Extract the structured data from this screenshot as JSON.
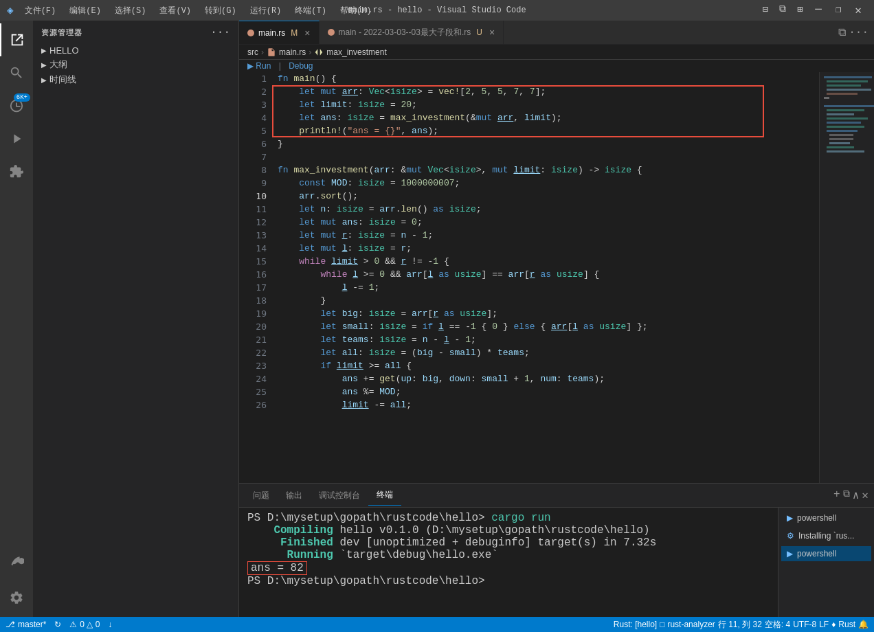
{
  "titlebar": {
    "icon": "◈",
    "menus": [
      "文件(F)",
      "编辑(E)",
      "选择(S)",
      "查看(V)",
      "转到(G)",
      "运行(R)",
      "终端(T)",
      "帮助(H)"
    ],
    "title": "main.rs - hello - Visual Studio Code",
    "controls": [
      "⊟",
      "❐",
      "✕"
    ]
  },
  "sidebar": {
    "title": "资源管理器",
    "tree": [
      {
        "label": "HELLO",
        "level": 0,
        "expanded": true
      },
      {
        "label": "大纲",
        "level": 0,
        "expanded": false
      },
      {
        "label": "时间线",
        "level": 0,
        "expanded": false
      }
    ]
  },
  "tabs": [
    {
      "label": "main.rs",
      "modified": true,
      "active": true,
      "icon": "rust"
    },
    {
      "label": "main - 2022-03-03--03最大子段和.rs",
      "modified": true,
      "active": false,
      "icon": "rust"
    }
  ],
  "breadcrumb": {
    "parts": [
      "src",
      "main.rs",
      "max_investment"
    ]
  },
  "run_debug": {
    "label": "Run | Debug"
  },
  "code": {
    "lines": [
      {
        "num": 1,
        "text": "fn main() {"
      },
      {
        "num": 2,
        "text": "    let mut arr: Vec<isize> = vec![2, 5, 5, 7, 7];"
      },
      {
        "num": 3,
        "text": "    let limit: isize = 20;"
      },
      {
        "num": 4,
        "text": "    let ans: isize = max_investment(&mut arr, limit);"
      },
      {
        "num": 5,
        "text": "    println!(\"ans = {}\", ans);"
      },
      {
        "num": 6,
        "text": "}"
      },
      {
        "num": 7,
        "text": ""
      },
      {
        "num": 8,
        "text": "fn max_investment(arr: &mut Vec<isize>, mut limit: isize) -> isize {"
      },
      {
        "num": 9,
        "text": "    const MOD: isize = 1000000007;"
      },
      {
        "num": 10,
        "text": "    arr.sort();"
      },
      {
        "num": 11,
        "text": "    let n: isize = arr.len() as isize;"
      },
      {
        "num": 12,
        "text": "    let mut ans: isize = 0;"
      },
      {
        "num": 13,
        "text": "    let mut r: isize = n - 1;"
      },
      {
        "num": 14,
        "text": "    let mut l: isize = r;"
      },
      {
        "num": 15,
        "text": "    while limit > 0 && r != -1 {"
      },
      {
        "num": 16,
        "text": "        while l >= 0 && arr[l as usize] == arr[r as usize] {"
      },
      {
        "num": 17,
        "text": "            l -= 1;"
      },
      {
        "num": 18,
        "text": "        }"
      },
      {
        "num": 19,
        "text": "        let big: isize = arr[r as usize];"
      },
      {
        "num": 20,
        "text": "        let small: isize = if l == -1 { 0 } else { arr[l as usize] };"
      },
      {
        "num": 21,
        "text": "        let teams: isize = n - l - 1;"
      },
      {
        "num": 22,
        "text": "        let all: isize = (big - small) * teams;"
      },
      {
        "num": 23,
        "text": "        if limit >= all {"
      },
      {
        "num": 24,
        "text": "            ans += get(up: big, down: small + 1, num: teams);"
      },
      {
        "num": 25,
        "text": "            ans %= MOD;"
      },
      {
        "num": 26,
        "text": "            limit -= all;"
      }
    ]
  },
  "panel_tabs": [
    "问题",
    "输出",
    "调试控制台",
    "终端"
  ],
  "terminal": {
    "lines": [
      {
        "type": "prompt",
        "text": "PS D:\\mysetup\\gopath\\rustcode\\hello> ",
        "cmd": "cargo run"
      },
      {
        "type": "compiling",
        "label": "Compiling",
        "text": " hello v0.1.0 (D:\\mysetup\\gopath\\rustcode\\hello)"
      },
      {
        "type": "finished",
        "label": "Finished",
        "text": " dev [unoptimized + debuginfo] target(s) in 7.32s"
      },
      {
        "type": "running",
        "label": "Running",
        "text": " `target\\debug\\hello.exe`"
      },
      {
        "type": "result",
        "text": "ans = 82"
      },
      {
        "type": "prompt",
        "text": "PS D:\\mysetup\\gopath\\rustcode\\hello> ",
        "cmd": ""
      }
    ]
  },
  "panel_right": [
    {
      "label": "powershell",
      "active": false
    },
    {
      "label": "Installing `rus...",
      "active": false
    },
    {
      "label": "powershell",
      "active": true
    }
  ],
  "status_bar": {
    "left": [
      {
        "icon": "⎇",
        "text": "master*"
      },
      {
        "icon": "↻",
        "text": ""
      },
      {
        "icon": "⚠",
        "text": "0"
      },
      {
        "icon": "⊗",
        "text": "0"
      },
      {
        "icon": "↓",
        "text": ""
      }
    ],
    "right": [
      {
        "text": "Rust: [hello]"
      },
      {
        "text": "□"
      },
      {
        "text": "rust-analyzer"
      },
      {
        "text": "行 11, 列 32"
      },
      {
        "text": "空格: 4"
      },
      {
        "text": "UTF-8"
      },
      {
        "text": "LF"
      },
      {
        "text": "♦"
      },
      {
        "text": "Rust"
      },
      {
        "text": "🔔"
      }
    ]
  }
}
